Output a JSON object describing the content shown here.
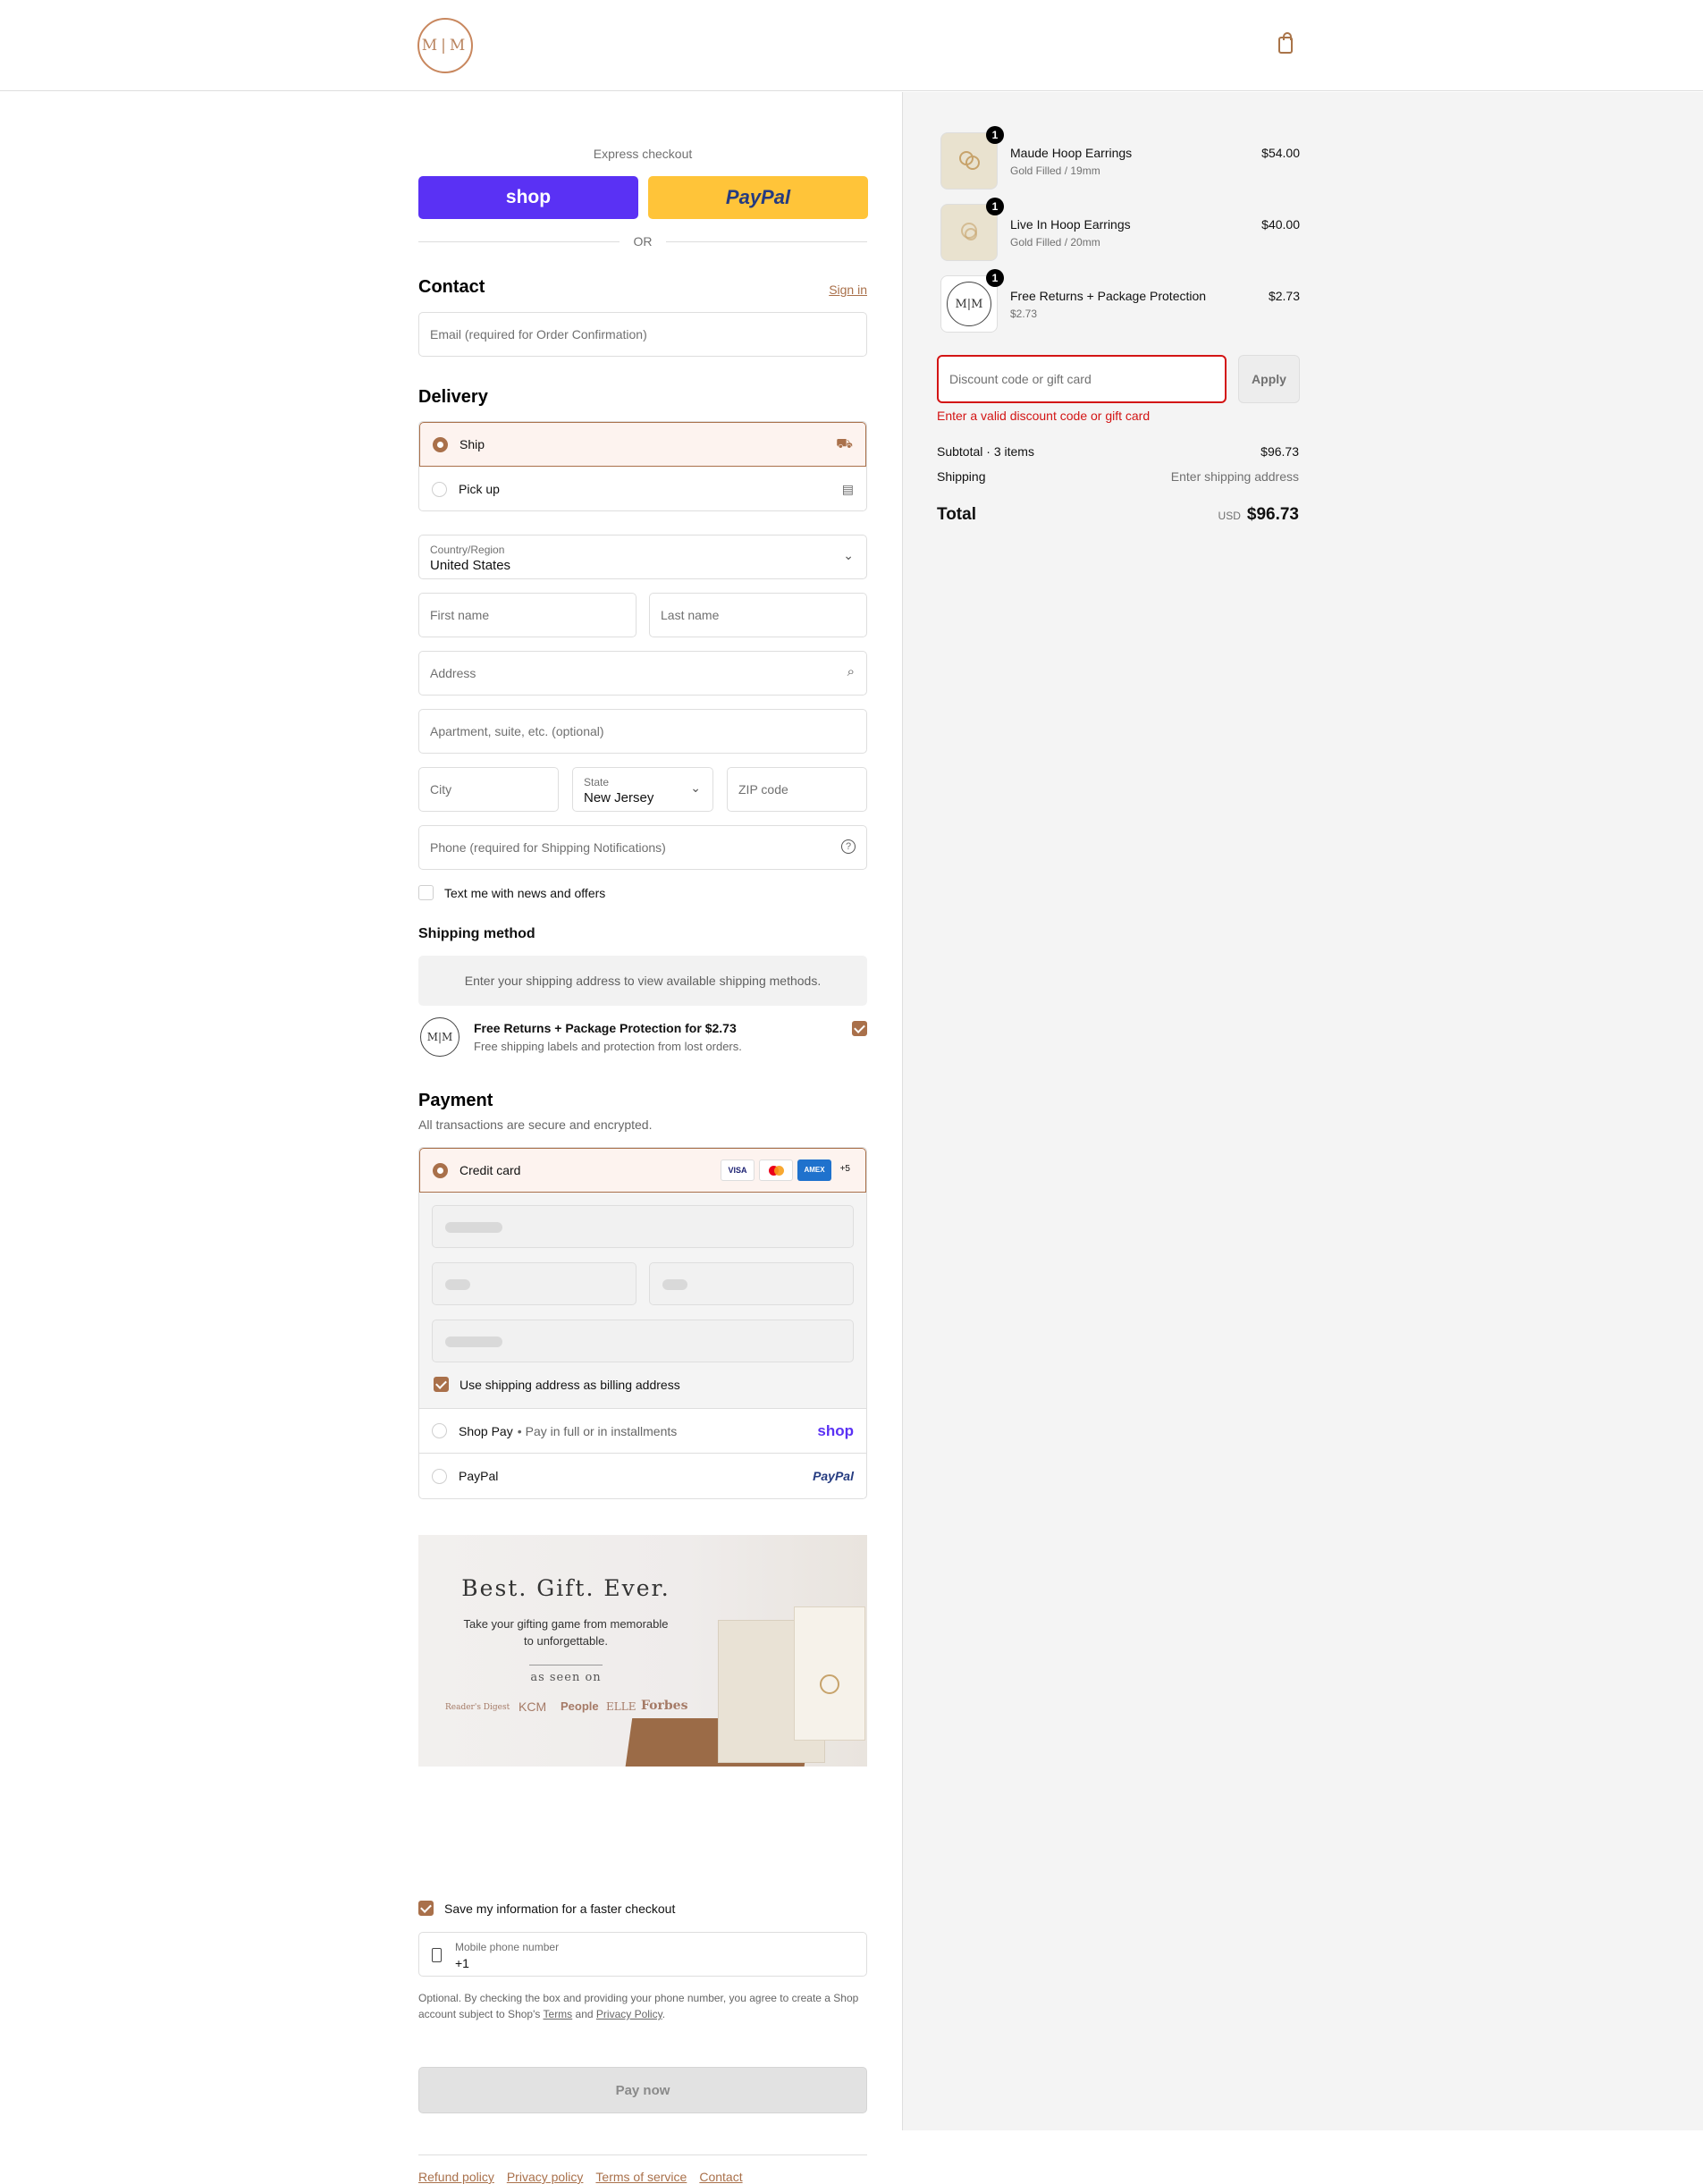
{
  "header": {
    "logo_text": "M|M",
    "cart_icon": "shopping-bag-icon"
  },
  "express": {
    "title": "Express checkout",
    "shop_label": "shop",
    "paypal_label": "PayPal",
    "or_label": "OR"
  },
  "contact": {
    "title": "Contact",
    "sign_in": "Sign in",
    "email_placeholder": "Email (required for Order Confirmation)"
  },
  "delivery": {
    "title": "Delivery",
    "options": [
      {
        "label": "Ship",
        "icon": "truck-icon",
        "selected": true
      },
      {
        "label": "Pick up",
        "icon": "store-icon",
        "selected": false
      }
    ],
    "country_label": "Country/Region",
    "country_value": "United States",
    "first_name": "First name",
    "last_name": "Last name",
    "address": "Address",
    "apartment": "Apartment, suite, etc. (optional)",
    "city": "City",
    "state_label": "State",
    "state_value": "New Jersey",
    "zip": "ZIP code",
    "phone": "Phone (required for Shipping Notifications)",
    "text_offers": "Text me with news and offers"
  },
  "shipping": {
    "title": "Shipping method",
    "message": "Enter your shipping address to view available shipping methods.",
    "protection_title": "Free Returns + Package Protection for $2.73",
    "protection_desc": "Free shipping labels and protection from lost orders."
  },
  "payment": {
    "title": "Payment",
    "subtitle": "All transactions are secure and encrypted.",
    "credit_card": "Credit card",
    "more_cards": "+5",
    "card_brands": [
      "VISA",
      "mastercard",
      "AMEX"
    ],
    "billing_same": "Use shipping address as billing address",
    "shop_pay": "Shop Pay",
    "shop_pay_note": "Pay in full or in installments",
    "shop_logo": "shop",
    "paypal": "PayPal",
    "paypal_logo": "PayPal"
  },
  "promo": {
    "headline": "Best. Gift. Ever.",
    "body_line1": "Take your gifting game from memorable",
    "body_line2": "to unforgettable.",
    "seen_on": "as seen on",
    "brands": [
      "Reader's Digest",
      "KCM",
      "People",
      "ELLE",
      "Forbes"
    ]
  },
  "save": {
    "label": "Save my information for a faster checkout",
    "phone_label": "Mobile phone number",
    "phone_prefix": "+1",
    "legal_1": "Optional. By checking the box and providing your phone number, you agree to create a Shop",
    "legal_2": "account subject to Shop's",
    "terms": "Terms",
    "and": "and",
    "privacy": "Privacy Policy",
    "period": "."
  },
  "pay_now": "Pay now",
  "footer": {
    "links": [
      "Refund policy",
      "Privacy policy",
      "Terms of service",
      "Contact"
    ]
  },
  "summary": {
    "items": [
      {
        "name": "Maude Hoop Earrings",
        "variant": "Gold Filled / 19mm",
        "price": "$54.00",
        "qty": "1"
      },
      {
        "name": "Live In Hoop Earrings",
        "variant": "Gold Filled / 20mm",
        "price": "$40.00",
        "qty": "1"
      },
      {
        "name": "Free Returns + Package Protection",
        "variant": "$2.73",
        "price": "$2.73",
        "qty": "1"
      }
    ],
    "discount_placeholder": "Discount code or gift card",
    "apply": "Apply",
    "error": "Enter a valid discount code or gift card",
    "subtotal_label": "Subtotal · 3 items",
    "subtotal": "$96.73",
    "shipping_label": "Shipping",
    "shipping_value": "Enter shipping address",
    "total_label": "Total",
    "currency": "USD",
    "total": "$96.73"
  },
  "colors": {
    "accent": "#a9704a",
    "shop_purple": "#5a31f4",
    "paypal_yellow": "#ffc439",
    "error": "#d31414"
  }
}
